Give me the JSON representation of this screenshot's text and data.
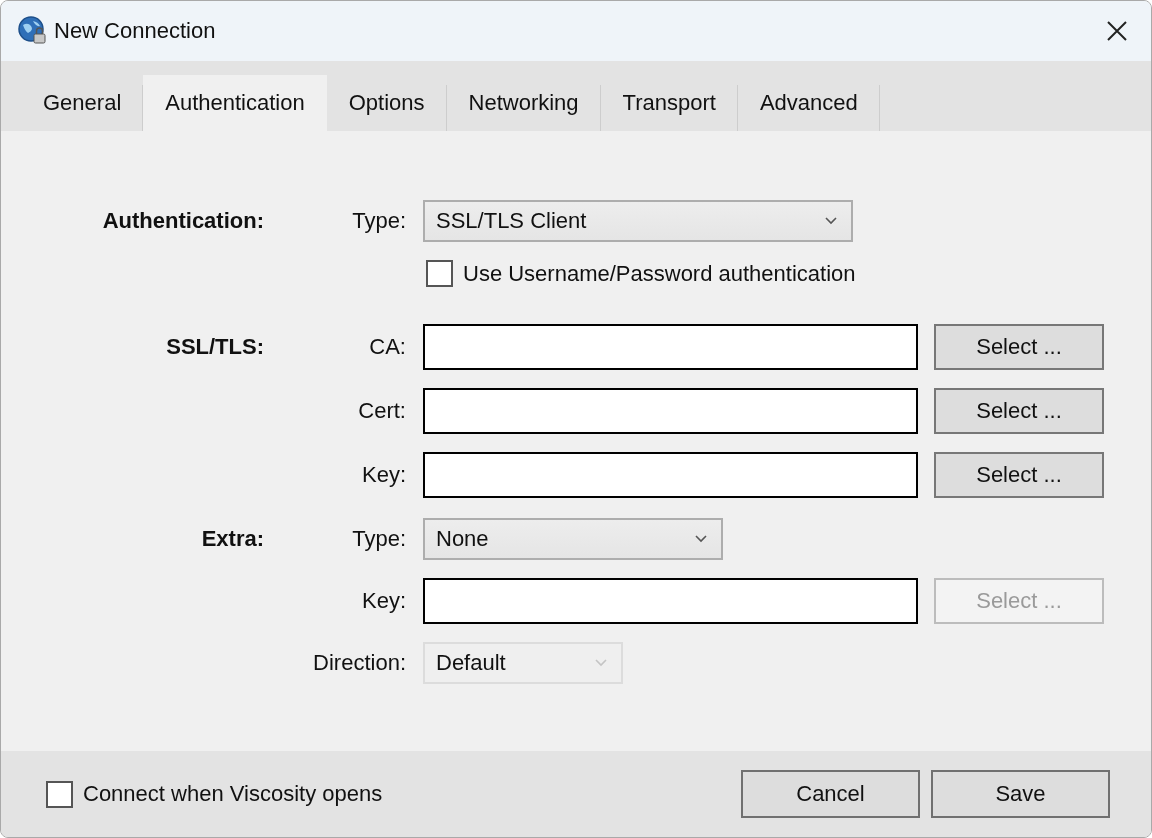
{
  "window": {
    "title": "New Connection"
  },
  "tabs": [
    {
      "label": "General",
      "selected": false
    },
    {
      "label": "Authentication",
      "selected": true
    },
    {
      "label": "Options",
      "selected": false
    },
    {
      "label": "Networking",
      "selected": false
    },
    {
      "label": "Transport",
      "selected": false
    },
    {
      "label": "Advanced",
      "selected": false
    }
  ],
  "sections": [
    {
      "heading": "Authentication:",
      "rows": [
        {
          "kind": "select",
          "label": "Type:",
          "value": "SSL/TLS Client",
          "disabled": false
        },
        {
          "kind": "checkbox",
          "label": "Use Username/Password authentication",
          "checked": false
        }
      ]
    },
    {
      "heading": "SSL/TLS:",
      "rows": [
        {
          "kind": "file",
          "label": "CA:",
          "button": "Select ...",
          "disabled": false
        },
        {
          "kind": "file",
          "label": "Cert:",
          "button": "Select ...",
          "disabled": false
        },
        {
          "kind": "file",
          "label": "Key:",
          "button": "Select ...",
          "disabled": false
        }
      ]
    },
    {
      "heading": "Extra:",
      "rows": [
        {
          "kind": "select",
          "label": "Type:",
          "value": "None",
          "disabled": false
        },
        {
          "kind": "file",
          "label": "Key:",
          "button": "Select ...",
          "disabled": true
        },
        {
          "kind": "select",
          "label": "Direction:",
          "value": "Default",
          "disabled": true
        }
      ]
    }
  ],
  "footer": {
    "checkbox": {
      "label": "Connect when Viscosity opens",
      "checked": false
    },
    "buttons": [
      "Cancel",
      "Save"
    ]
  }
}
